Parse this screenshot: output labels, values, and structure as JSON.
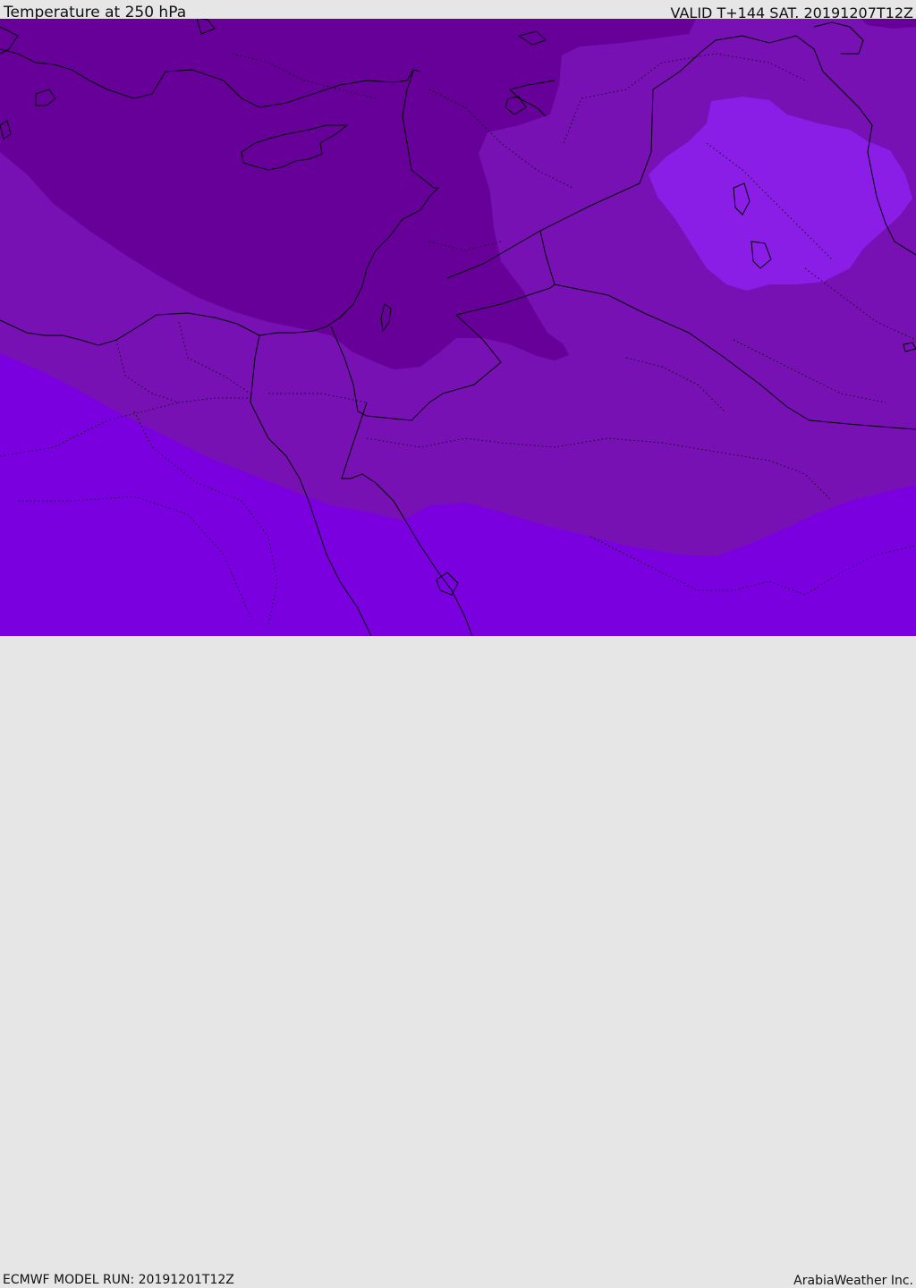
{
  "header": {
    "title": "Temperature at 250 hPa",
    "valid_time": "VALID T+144 SAT. 20191207T12Z"
  },
  "footer": {
    "model_run": "ECMWF MODEL RUN: 20191201T12Z",
    "credit": "ArabiaWeather Inc."
  },
  "map": {
    "field": "temperature_250hPa",
    "shading_colors": [
      "#670099",
      "#7711b3",
      "#7b00e0",
      "#8a1ee6"
    ],
    "boundary_color": "#000000"
  }
}
